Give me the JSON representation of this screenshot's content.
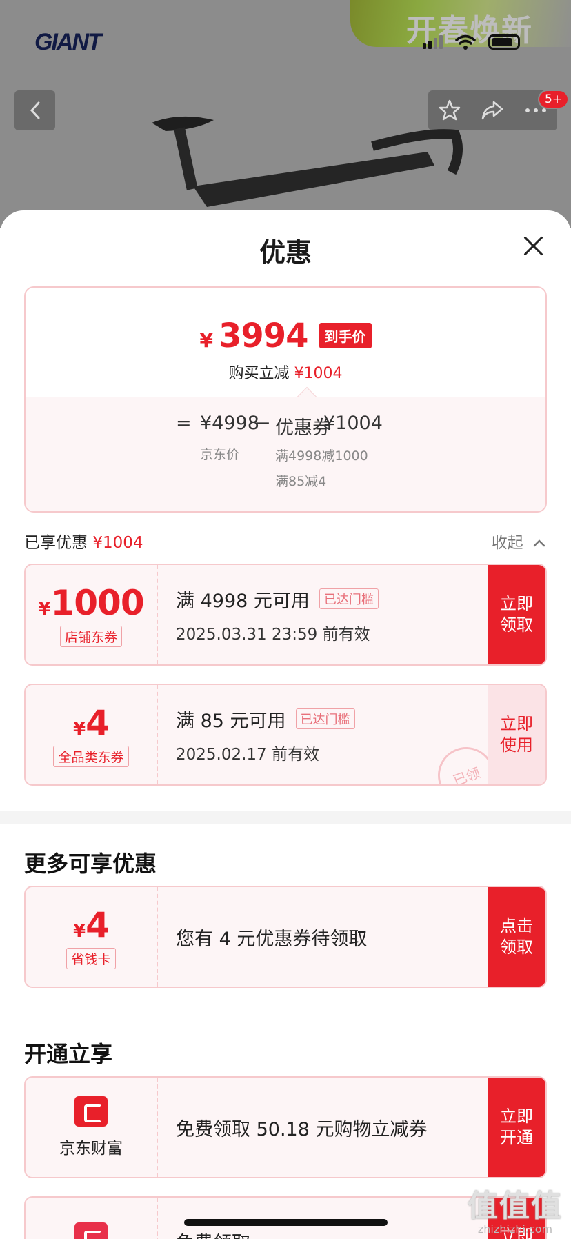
{
  "background": {
    "banner_text": "开春焕新",
    "logo_text": "GIANT",
    "notification_count": "5+"
  },
  "sheet": {
    "title": "优惠",
    "price": {
      "yen": "¥",
      "final_price": "3994",
      "final_tag": "到手价",
      "reduce_label": "购买立减",
      "reduce_amount": "¥1004",
      "equals": "=",
      "jd_price": "¥4998",
      "jd_price_label": "京东价",
      "minus": "−",
      "coupon_label": "优惠券",
      "coupon_amount": "¥1004",
      "coupon_rule_1": "满4998减1000",
      "coupon_rule_2": "满85减4"
    },
    "enjoyed": {
      "label": "已享优惠",
      "amount": "¥1004",
      "collapse_label": "收起"
    },
    "coupons": [
      {
        "yen": "¥",
        "amount": "1000",
        "type": "店铺东券",
        "condition": "满 4998 元可用",
        "status": "已达门槛",
        "valid": "2025.03.31 23:59 前有效",
        "button": "立即\n领取"
      },
      {
        "yen": "¥",
        "amount": "4",
        "type": "全品类东券",
        "condition": "满 85 元可用",
        "status": "已达门槛",
        "valid": "2025.02.17 前有效",
        "button": "立即\n使用",
        "stamp": "已领"
      }
    ],
    "more": {
      "title": "更多可享优惠",
      "card": {
        "yen": "¥",
        "amount": "4",
        "type": "省钱卡",
        "text": "您有 4 元优惠券待领取",
        "button": "点击\n领取"
      }
    },
    "open": {
      "title": "开通立享",
      "card": {
        "brand": "京东财富",
        "text": "免费领取 50.18 元购物立减券",
        "button": "立即\n开通"
      },
      "partial_card": {
        "text": "免费领取",
        "button": "立即"
      }
    }
  },
  "watermark": {
    "big": "值值值",
    "small": "zhizhizhi.com"
  },
  "colors": {
    "accent": "#e8202a",
    "coupon_bg": "#fdf5f6",
    "coupon_border": "#f6c9cc"
  }
}
